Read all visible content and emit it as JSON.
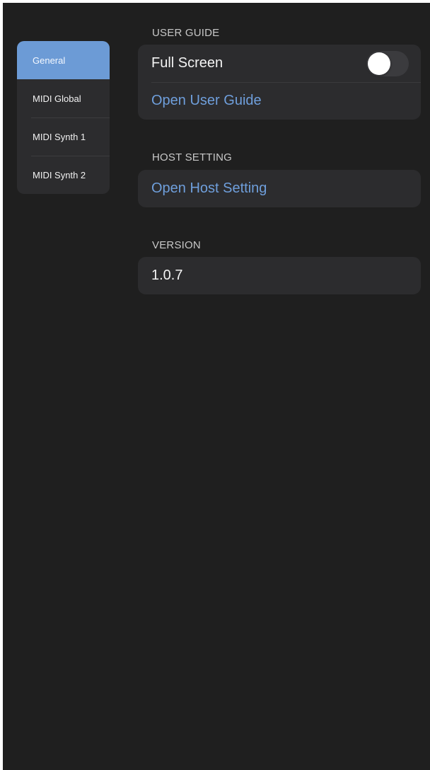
{
  "sidebar": {
    "items": [
      {
        "label": "General",
        "active": true
      },
      {
        "label": "MIDI Global",
        "active": false
      },
      {
        "label": "MIDI Synth 1",
        "active": false
      },
      {
        "label": "MIDI Synth 2",
        "active": false
      }
    ]
  },
  "sections": {
    "user_guide": {
      "header": "USER GUIDE",
      "full_screen_label": "Full Screen",
      "full_screen_on": false,
      "open_user_guide": "Open User Guide"
    },
    "host_setting": {
      "header": "HOST SETTING",
      "open_host_setting": "Open Host Setting"
    },
    "version": {
      "header": "VERSION",
      "value": "1.0.7"
    }
  },
  "colors": {
    "background": "#1f1f1f",
    "card": "#2c2c2e",
    "accent": "#6c9bd6",
    "link": "#6f9fdc",
    "toggle_off": "#3b3b3e"
  }
}
